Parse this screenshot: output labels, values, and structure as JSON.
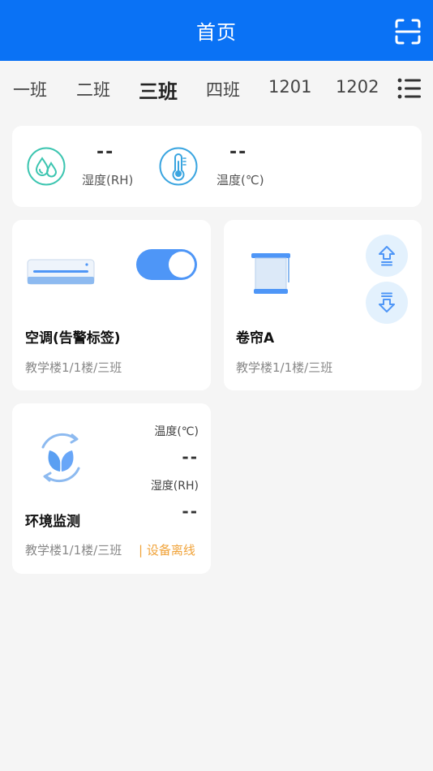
{
  "header": {
    "title": "首页"
  },
  "tabs": [
    {
      "label": "一班"
    },
    {
      "label": "二班"
    },
    {
      "label": "三班"
    },
    {
      "label": "四班"
    },
    {
      "label": "1201"
    },
    {
      "label": "1202"
    }
  ],
  "active_tab": "三班",
  "env_summary": {
    "humidity": {
      "value": "--",
      "unit": "湿度(RH)"
    },
    "temperature": {
      "value": "--",
      "unit": "温度(℃)"
    }
  },
  "devices": {
    "ac": {
      "name": "空调(告警标签)",
      "location": "教学楼1/1楼/三班",
      "switch_on": true
    },
    "curtain": {
      "name": "卷帘A",
      "location": "教学楼1/1楼/三班"
    },
    "env_monitor": {
      "name": "环境监测",
      "location": "教学楼1/1楼/三班",
      "status": "| 设备离线",
      "temperature_label": "温度(℃)",
      "temperature_value": "--",
      "humidity_label": "湿度(RH)",
      "humidity_value": "--"
    }
  },
  "colors": {
    "header": "#0a72f5",
    "accent": "#4e96f7",
    "offline": "#f0a33a",
    "humidity_icon": "#3cc5b0",
    "temperature_icon": "#3aa5e0"
  }
}
